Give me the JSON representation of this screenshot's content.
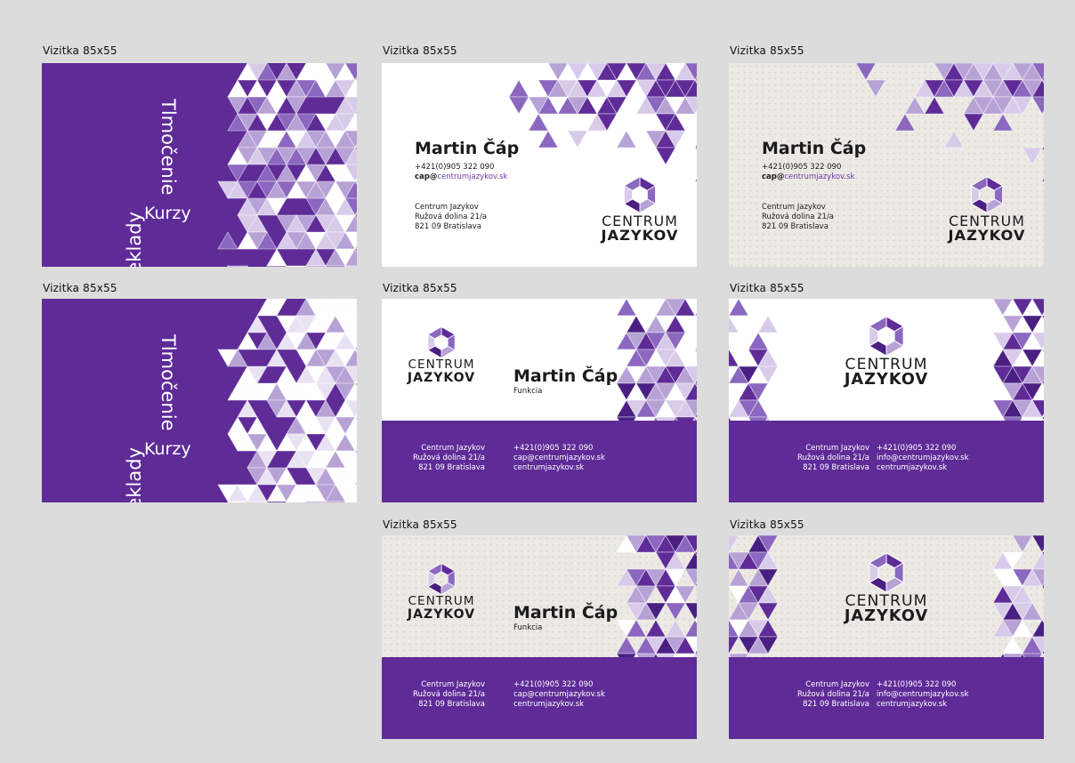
{
  "card_label": "Vizitka 85x55",
  "colors": {
    "purple": "#5e2b97",
    "light_purple": "#b7a2d6",
    "mid_purple": "#8b67bf",
    "background": "#dcdcdc"
  },
  "services": {
    "a": "Tlmočenie",
    "b": "Preklady",
    "c": "Kurzy"
  },
  "person": {
    "name": "Martin Čáp",
    "function": "Funkcia",
    "phone": "+421(0)905 322 090",
    "email_user": "cap@",
    "email_domain": "centrumjazykov.sk",
    "email": "cap@centrumjazykov.sk"
  },
  "company": {
    "name": "Centrum Jazykov",
    "street": "Ružová dolina 21/a",
    "city": "821 09 Bratislava",
    "web": "centrumjazykov.sk",
    "info_email": "info@centrumjazykov.sk"
  },
  "logo": {
    "icon": "hexagon-triangles-icon",
    "line1": "CENTRUM",
    "line2": "JAZYKOV"
  }
}
